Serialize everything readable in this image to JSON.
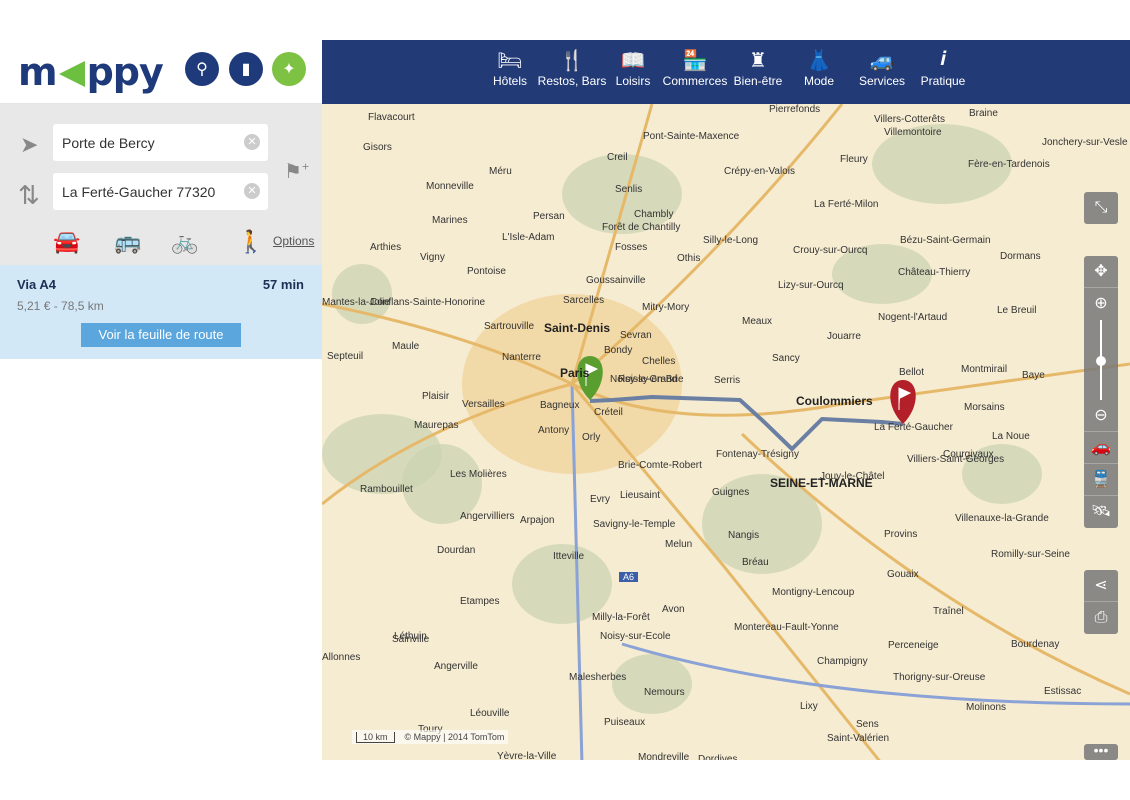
{
  "logo": "mappy",
  "header_buttons": [
    {
      "icon": "map-pin-icon"
    },
    {
      "icon": "shopping-bag-icon"
    },
    {
      "icon": "signpost-icon",
      "active": true
    }
  ],
  "route_form": {
    "origin": "Porte de Bercy",
    "destination": "La Ferté-Gaucher 77320",
    "options_label": "Options",
    "modes": [
      {
        "icon": "car-icon",
        "active": true
      },
      {
        "icon": "bus-icon"
      },
      {
        "icon": "bike-icon"
      },
      {
        "icon": "walk-icon"
      }
    ]
  },
  "result": {
    "via": "Via A4",
    "duration": "57 min",
    "cost_distance": "5,21 € - 78,5 km",
    "button": "Voir la feuille de route"
  },
  "categories": [
    {
      "label": "Hôtels",
      "icon": "bed-icon"
    },
    {
      "label": "Restos, Bars",
      "icon": "fork-knife-icon"
    },
    {
      "label": "Loisirs",
      "icon": "book-icon"
    },
    {
      "label": "Commerces",
      "icon": "shop-icon"
    },
    {
      "label": "Bien-être",
      "icon": "perfume-icon"
    },
    {
      "label": "Mode",
      "icon": "dress-icon"
    },
    {
      "label": "Services",
      "icon": "car-service-icon"
    },
    {
      "label": "Pratique",
      "icon": "info-icon"
    }
  ],
  "map": {
    "towns": [
      "Flavacourt",
      "Gisors",
      "Méru",
      "Creil",
      "Pont-Sainte-Maxence",
      "Pierrefonds",
      "Villers-Cotterêts",
      "Braine",
      "Jonchery-sur-Vesle",
      "Villemontoire",
      "Crépy-en-Valois",
      "Fleury",
      "Senlis",
      "Chambly",
      "Persan",
      "L'Isle-Adam",
      "Fosses",
      "Forêt de Chantilly",
      "La Ferté-Milon",
      "Fère-en-Tardenois",
      "Monneville",
      "Marines",
      "Arthies",
      "Vigny",
      "Pontoise",
      "Sarcelles",
      "Goussainville",
      "Othis",
      "Silly-le-Long",
      "Crouy-sur-Ourcq",
      "Bézu-Saint-Germain",
      "Dormans",
      "Château-Thierry",
      "Mantes-la-Jolie",
      "Conflans-Sainte-Honorine",
      "Saint-Denis",
      "Mitry-Mory",
      "Meaux",
      "Lizy-sur-Ourcq",
      "Sartrouville",
      "Sevran",
      "Nogent-l'Artaud",
      "Le Breuil",
      "Nanterre",
      "Bondy",
      "Chelles",
      "Jouarre",
      "Septeuil",
      "Maule",
      "Paris",
      "Noisy-le-Grand",
      "Serris",
      "Sancy",
      "Bellot",
      "Montmirail",
      "Baye",
      "Plaisir",
      "Versailles",
      "Bagneux",
      "Créteil",
      "Roissy-en-Brie",
      "Coulommiers",
      "La Ferté-Gaucher",
      "Morsains",
      "Maurepas",
      "Antony",
      "Orly",
      "Fontenay-Trésigny",
      "La Noue",
      "Courgivaux",
      "Les Molières",
      "Brie-Comte-Robert",
      "Rambouillet",
      "Evry",
      "Lieusaint",
      "Guignes",
      "Jouy-le-Châtel",
      "Villiers-Saint-Georges",
      "SEINE-ET-MARNE",
      "Angervilliers",
      "Arpajon",
      "Savigny-le-Temple",
      "Provins",
      "Villenauxe-la-Grande",
      "Dourdan",
      "Itteville",
      "Melun",
      "Nangis",
      "Bréau",
      "Romilly-sur-Seine",
      "Etampes",
      "Gouaix",
      "Montigny-Lencoup",
      "Sainville",
      "Milly-la-Forêt",
      "Avon",
      "Montereau-Fault-Yonne",
      "Traînel",
      "Léthuin",
      "Noisy-sur-Ecole",
      "Perceneige",
      "Bourdenay",
      "Allonnes",
      "Angerville",
      "Champigny",
      "Thorigny-sur-Oreuse",
      "Malesherbes",
      "Nemours",
      "Estissac",
      "Léouville",
      "Lixy",
      "Molinons",
      "Puiseaux",
      "Sens",
      "Saint-Valérien",
      "Yèvre-la-Ville",
      "Mondreville",
      "Dordives",
      "Toury"
    ],
    "scale": "10 km",
    "attribution": "© Mappy | 2014 TomTom",
    "road_label": "A6",
    "route_color": "#6b7fa3",
    "start_flag_color": "#5a9e2f",
    "end_flag_color": "#b3202a"
  },
  "map_controls": [
    {
      "icon": "fullscreen-collapse-icon"
    },
    {
      "icon": "recenter-icon"
    },
    {
      "icon": "zoom-in-icon"
    },
    {
      "icon": "zoom-out-icon"
    },
    {
      "icon": "traffic-icon"
    },
    {
      "icon": "transit-icon"
    },
    {
      "icon": "satellite-icon"
    },
    {
      "icon": "share-icon"
    },
    {
      "icon": "print-icon"
    },
    {
      "icon": "more-icon"
    }
  ],
  "zoom_level": 0.45
}
